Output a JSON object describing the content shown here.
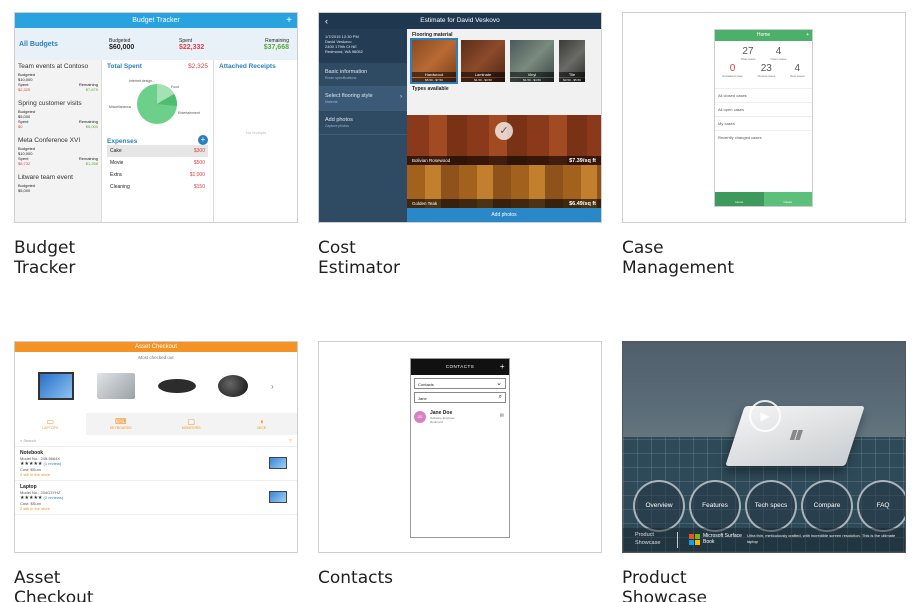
{
  "cards": {
    "budget": {
      "caption": "Budget Tracker"
    },
    "cost": {
      "caption": "Cost Estimator"
    },
    "case": {
      "caption": "Case Management"
    },
    "asset": {
      "caption": "Asset Checkout"
    },
    "contacts": {
      "caption": "Contacts"
    },
    "showcase": {
      "caption": "Product Showcase"
    }
  },
  "budget_app": {
    "title": "Budget Tracker",
    "all_budgets": "All Budgets",
    "budgeted_label": "Budgeted",
    "budgeted_value": "$60,000",
    "spent_label": "Spent",
    "spent_value": "$22,332",
    "remaining_label": "Remaining",
    "remaining_value": "$37,668",
    "events": [
      {
        "title": "Team events at Contoso",
        "budgeted": "$10,000",
        "spent": "$2,325",
        "remaining": "$7,675"
      },
      {
        "title": "Spring customer visits",
        "budgeted": "$5,000",
        "spent": "$0",
        "remaining": "$5,000"
      },
      {
        "title": "Meta Conference XVI",
        "budgeted": "$10,000",
        "spent": "$8,732",
        "remaining": "$1,268"
      },
      {
        "title": "Litware team event",
        "budgeted": "$5,000",
        "spent": "",
        "remaining": ""
      }
    ],
    "total_spent_label": "Total Spent",
    "total_spent_value": "$2,325",
    "pie_labels": [
      "Internet design...",
      "Food",
      "Entertainment",
      "Miscellaneous"
    ],
    "expenses_label": "Expenses",
    "expenses": [
      {
        "name": "Cake",
        "value": "$300"
      },
      {
        "name": "Movie",
        "value": "$500"
      },
      {
        "name": "Extra",
        "value": "$1,000"
      },
      {
        "name": "Cleaning",
        "value": "$150"
      }
    ],
    "attached_receipts": "Attached Receipts",
    "no_receipts": "No receipts",
    "colors": {
      "accent": "#29a3e0",
      "red": "#e04040",
      "green": "#5aa838",
      "pie_green": "#6ccf8a"
    }
  },
  "cost_app": {
    "title": "Estimate for David Veskovo",
    "info": [
      "1/7/2015 12:30 PM",
      "David Veskovo",
      "2400 179th Ct NE",
      "Redmond, WA 98052"
    ],
    "nav": [
      {
        "label": "Basic information",
        "sub": "Room specifications"
      },
      {
        "label": "Select flooring style",
        "sub": "Material"
      },
      {
        "label": "Add photos",
        "sub": "Capture photos"
      }
    ],
    "flooring_material": "Flooring material",
    "tiles": [
      {
        "name": "Hardwood",
        "price": "$5.50 - $7.50"
      },
      {
        "name": "Laminate",
        "price": "$1.50 - $3.50"
      },
      {
        "name": "Vinyl",
        "price": "$1.50 - $4.50"
      },
      {
        "name": "Tile",
        "price": "$3.50 - $5.50"
      }
    ],
    "types_available": "Types available",
    "woods": [
      {
        "name": "Bolivian Rosewood",
        "price": "$7.39/sq ft"
      },
      {
        "name": "Golden Teak",
        "price": "$6.49/sq ft"
      }
    ],
    "add_photos": "Add photos"
  },
  "case_app": {
    "title": "Home",
    "stats_top": [
      {
        "value": "27",
        "label": "Total cases"
      },
      {
        "value": "4",
        "label": "Open cases"
      }
    ],
    "stats_bottom": [
      {
        "value": "0",
        "label": "Escalated case"
      },
      {
        "value": "23",
        "label": "Closed cases"
      },
      {
        "value": "4",
        "label": "New cases"
      }
    ],
    "list": [
      "All closed cases",
      "All open cases",
      "My cases",
      "Recently changed cases"
    ],
    "footer": [
      "Home",
      "Cases"
    ]
  },
  "asset_app": {
    "title": "Asset Checkout",
    "subtitle": "Most checked out",
    "categories": [
      "LAPTOPS",
      "KEYBOARDS",
      "MONITORS",
      "MICE"
    ],
    "search": "Search",
    "items": [
      {
        "name": "Notebook",
        "model": "Model No.: 245-5664X",
        "reviews": "(1 review)",
        "cost": "Cost: $Sum",
        "available": "2 still in the store"
      },
      {
        "name": "Laptop",
        "model": "Model No.: 234G3YHZ",
        "reviews": "(2 reviews)",
        "cost": "Cost: $Sum",
        "available": "2 still in the store"
      }
    ]
  },
  "contacts_app": {
    "title": "CONTACTS",
    "dropdown": "Contacts",
    "search_value": "Jane",
    "contact": {
      "initials": "JD",
      "name": "Jane Doe",
      "role": "Software Engineer",
      "city": "Redmond"
    }
  },
  "showcase_app": {
    "buttons": [
      "Overview",
      "Features",
      "Tech specs",
      "Compare",
      "FAQ"
    ],
    "product_line": "Product Showcase",
    "brand": "Microsoft Surface Book",
    "tagline": "Ultra thin, meticulously crafted, with incredible screen resolution. This is the ultimate laptop"
  }
}
